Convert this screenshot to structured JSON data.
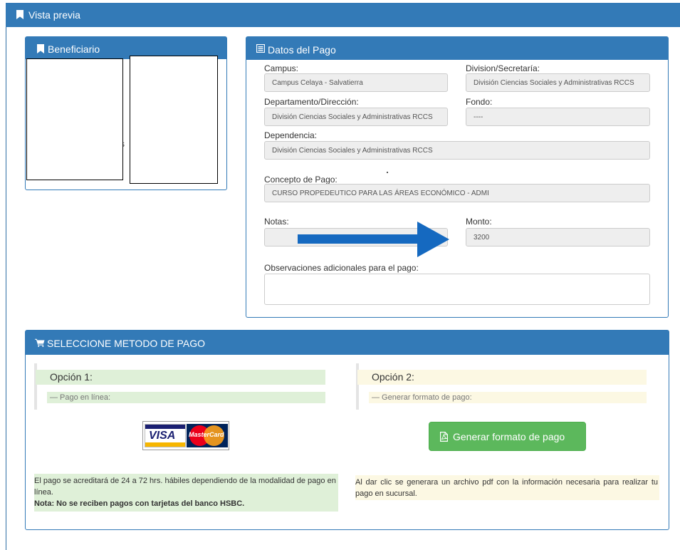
{
  "header": {
    "title": "Vista previa"
  },
  "beneficiario": {
    "title": "Beneficiario",
    "partial_letter": "s"
  },
  "datos_pago": {
    "title": "Datos del Pago",
    "campus": {
      "label": "Campus:",
      "value": "Campus Celaya - Salvatierra"
    },
    "division": {
      "label": "Division/Secretaría:",
      "value": "División Ciencias Sociales y Administrativas RCCS"
    },
    "departamento": {
      "label": "Departamento/Dirección:",
      "value": "División Ciencias Sociales y Administrativas RCCS"
    },
    "fondo": {
      "label": "Fondo:",
      "value": "----"
    },
    "dependencia": {
      "label": "Dependencia:",
      "value": "División Ciencias Sociales y Administrativas RCCS"
    },
    "concepto": {
      "label": "Concepto de Pago:",
      "value": "CURSO PROPEDEUTICO PARA LAS ÁREAS ECONÓMICO - ADMI"
    },
    "notas": {
      "label": "Notas:",
      "value": ""
    },
    "monto": {
      "label": "Monto:",
      "value": "3200"
    },
    "observaciones": {
      "label": "Observaciones adicionales para el pago:",
      "value": ""
    }
  },
  "metodo_pago": {
    "title": "SELECCIONE METODO DE PAGO",
    "option1": {
      "title": "Opción 1:",
      "subtitle": "— Pago en línea:",
      "card_visa": "VISA",
      "card_mastercard": "MasterCard",
      "note": "El pago se acreditará de 24 a 72 hrs. hábiles dependiendo de la modalidad de pago en línea.",
      "note_bold": "Nota: No se reciben pagos con tarjetas del banco HSBC."
    },
    "option2": {
      "title": "Opción 2:",
      "subtitle": "— Generar formato de pago:",
      "button_label": "Generar formato de pago",
      "note": "Al dar clic se generara un archivo pdf con la información necesaria para realizar tu pago en sucursal."
    }
  },
  "colors": {
    "primary": "#337ab7",
    "success": "#5cb85c",
    "arrow": "#1569c0",
    "green_bg": "#dff0d8",
    "cream_bg": "#fcf8e3"
  },
  "icons": {
    "header": "bookmark-icon",
    "beneficiario": "bookmark-icon",
    "datos": "list-alt-icon",
    "metodo": "shopping-cart-icon",
    "button": "pdf-file-icon"
  }
}
